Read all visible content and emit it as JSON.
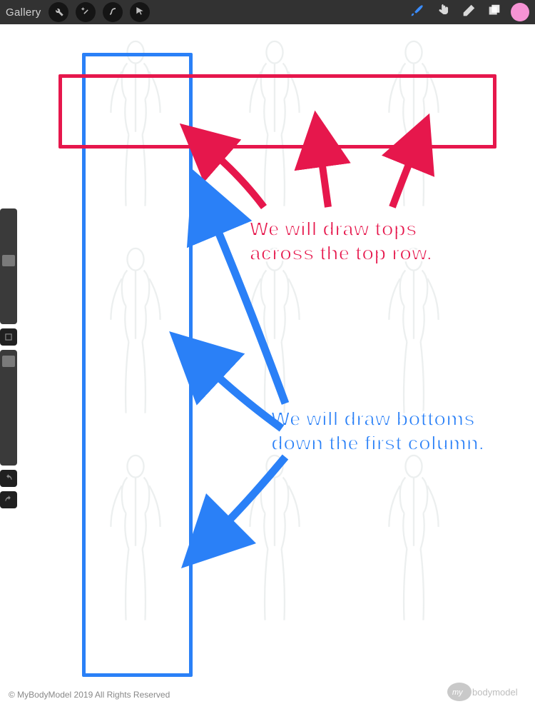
{
  "toolbar": {
    "gallery_label": "Gallery",
    "tools": {
      "actions": "wrench-icon",
      "adjust": "wand-icon",
      "transform": "s-curve-icon",
      "move": "pointer-icon"
    },
    "right": {
      "brush": "brush-icon",
      "smudge": "finger-icon",
      "erase": "eraser-icon",
      "layers": "layers-icon",
      "color": "#f693d4"
    }
  },
  "annotations": {
    "tops_text": "We will draw tops across the top row.",
    "bottoms_text": "We will draw bottoms down the first column."
  },
  "footer": {
    "copyright": "© MyBodyModel 2019 All Rights Reserved",
    "logo_text": "mybodymodel"
  },
  "colors": {
    "pink": "#e6174c",
    "blue": "#2a80f7"
  }
}
